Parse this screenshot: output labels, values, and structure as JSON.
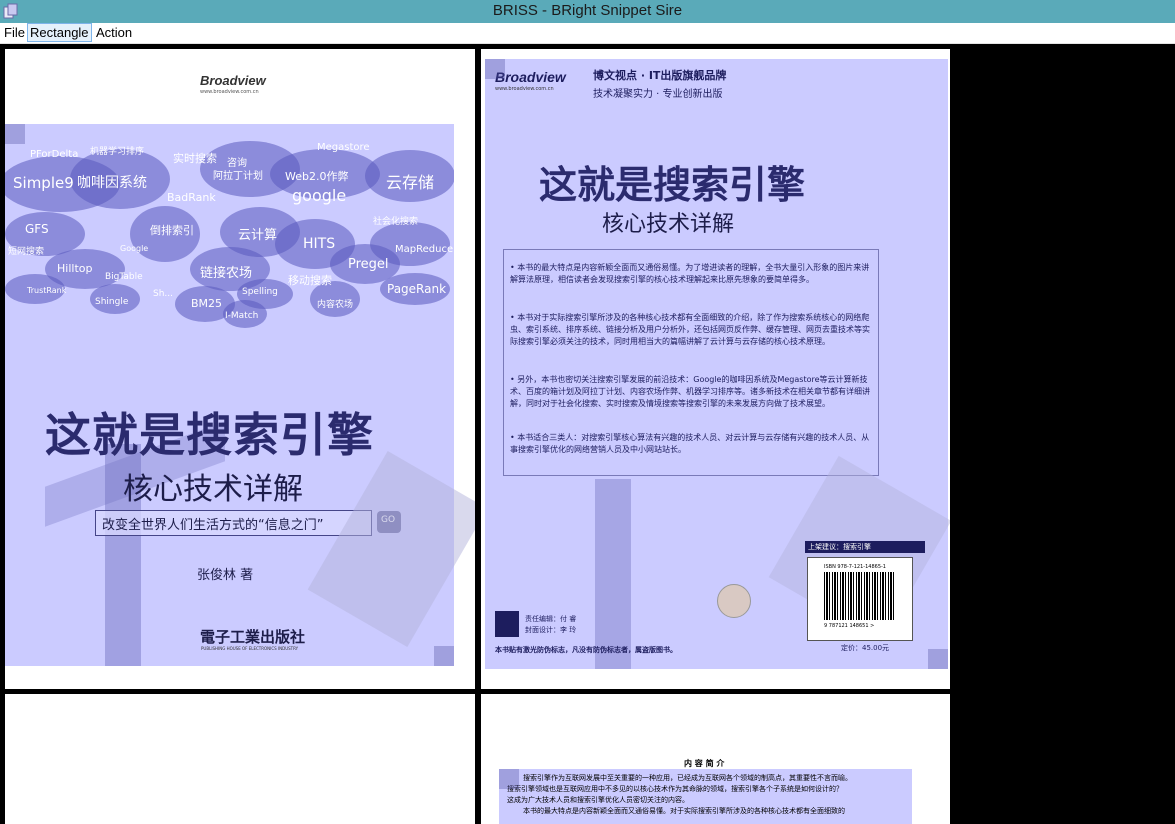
{
  "window": {
    "title": "BRISS - BRight Snippet Sire"
  },
  "menu": {
    "file": "File",
    "rectangle": "Rectangle",
    "action": "Action"
  },
  "page1": {
    "publisher_logo": "Broadview",
    "publisher_url": "www.broadview.com.cn",
    "title": "这就是搜索引擎",
    "subtitle": "核心技术详解",
    "slogan": "改变全世界人们生活方式的“信息之门”",
    "go": "GO",
    "author": "张俊林 著",
    "press": "電子工業出版社",
    "press_en": "PUBLISHING HOUSE OF ELECTRONICS INDUSTRY",
    "cloud_words": [
      "PForDelta",
      "机器学习排序",
      "实时搜索",
      "Megastore",
      "Simple9",
      "咖啡因系统",
      "咨询",
      "阿拉丁计划",
      "Web2.0作弊",
      "云存储",
      "BadRank",
      "google",
      "GFS",
      "倒排索引",
      "云计算",
      "HITS",
      "社会化搜索",
      "Pregel",
      "MapReduce",
      "短网搜索",
      "Hilltop",
      "BigTable",
      "链接农场",
      "移动搜索",
      "TrustRank",
      "Shingle",
      "Sh...",
      "BM25",
      "Spelling",
      "PageRank",
      "I-Match",
      "内容农场",
      "Google"
    ]
  },
  "page2": {
    "logo": "Broadview",
    "logo_url": "www.broadview.com.cn",
    "brand_line1": "博文视点 · IT出版旗舰品牌",
    "brand_line2": "技术凝聚实力 · 专业创新出版",
    "title": "这就是搜索引擎",
    "subtitle": "核心技术详解",
    "bullets": [
      "本书的最大特点是内容新颖全面而又通俗易懂。为了增进读者的理解，全书大量引入形象的图片来讲解算法原理，相信读者会发现搜索引擎的核心技术理解起来比原先想象的要简单得多。",
      "本书对于实际搜索引擎所涉及的各种核心技术都有全面细致的介绍，除了作为搜索系统核心的网络爬虫、索引系统、排序系统、链接分析及用户分析外，还包括网页反作弊、缓存管理、网页去重技术等实际搜索引擎必须关注的技术，同时用相当大的篇幅讲解了云计算与云存储的核心技术原理。",
      "另外，本书也密切关注搜索引擎发展的前沿技术：Google的咖啡因系统及Megastore等云计算新技术、百度的箱计划及阿拉丁计划、内容农场作弊、机器学习排序等。诸多新技术在相关章节都有详细讲解，同时对于社会化搜索、实时搜索及情境搜索等搜索引擎的未来发展方向做了技术展望。",
      "本书适合三类人：对搜索引擎核心算法有兴趣的技术人员、对云计算与云存储有兴趣的技术人员、从事搜索引擎优化的网络营销人员及中小网站站长。"
    ],
    "category": "上架建议：搜索引擎",
    "isbn": "ISBN 978-7-121-14865-1",
    "barcode_digits": "9 787121 148651 >",
    "price": "定价：45.00元",
    "editor": "责任编辑：付 睿",
    "designer": "封面设计：李 玲",
    "antifake": "本书贴有激光防伪标志，凡没有防伪标志者，属盗版图书。"
  },
  "page4": {
    "heading": "内 容 简 介",
    "lines": [
      "搜索引擎作为互联网发展中至关重要的一种应用，已经成为互联网各个领域的制高点，其重要性不言而喻。",
      "搜索引擎领域也是互联网应用中不多见的以核心技术作为其命脉的领域，搜索引擎各个子系统是如何设计的？",
      "这成为广大技术人员和搜索引擎优化人员密切关注的内容。",
      "本书的最大特点是内容新颖全面而又通俗易懂。对于实际搜索引擎所涉及的各种核心技术都有全面细致的"
    ]
  }
}
